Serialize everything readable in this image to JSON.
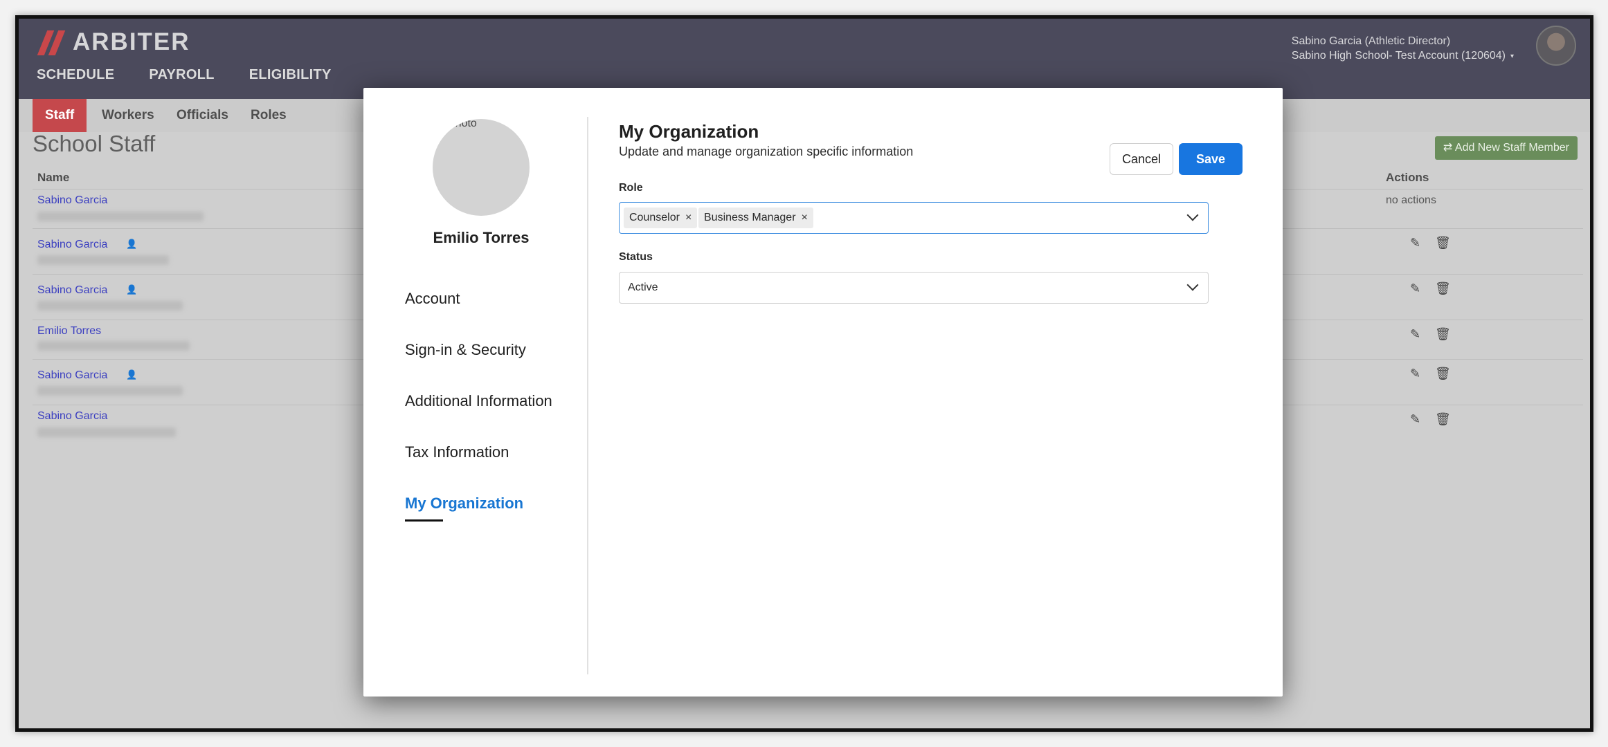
{
  "app": {
    "logo_text": "ARBITER",
    "nav": [
      "SCHEDULE",
      "PAYROLL",
      "ELIGIBILITY"
    ],
    "user_line1": "Sabino Garcia (Athletic Director)",
    "user_line2": "Sabino High School- Test Account (120604)"
  },
  "subnav": {
    "tabs": [
      "Staff",
      "Workers",
      "Officials",
      "Roles"
    ],
    "active": "Staff"
  },
  "page": {
    "title": "School Staff",
    "add_button": "Add New Staff Member",
    "col_name": "Name",
    "col_actions": "Actions",
    "rows": [
      {
        "name": "Sabino Garcia",
        "actions": "no actions"
      },
      {
        "name": "Sabino Garcia"
      },
      {
        "name": "Sabino Garcia"
      },
      {
        "name": "Emilio Torres"
      },
      {
        "name": "Sabino Garcia"
      },
      {
        "name": "Sabino Garcia"
      }
    ]
  },
  "modal": {
    "photo_alt": "Photo",
    "profile_name": "Emilio Torres",
    "menu": [
      "Account",
      "Sign-in & Security",
      "Additional Information",
      "Tax Information",
      "My Organization"
    ],
    "active_menu": "My Organization",
    "title": "My Organization",
    "subtitle": "Update and manage organization specific information",
    "cancel_label": "Cancel",
    "save_label": "Save",
    "role_label": "Role",
    "roles": [
      "Counselor",
      "Business Manager"
    ],
    "remove_glyph": "×",
    "status_label": "Status",
    "status_value": "Active"
  },
  "colors": {
    "header_bg": "#4b4a5c",
    "brand_red": "#c5484c",
    "primary_blue": "#1876e0",
    "link_blue": "#1876d2"
  }
}
